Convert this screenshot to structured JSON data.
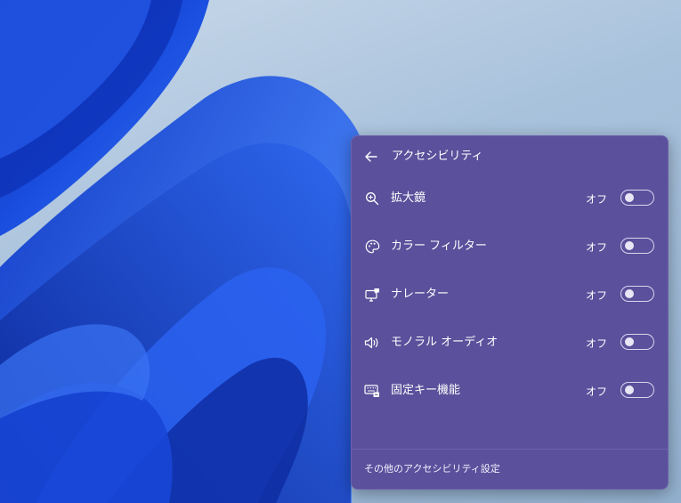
{
  "panel": {
    "title": "アクセシビリティ",
    "back_icon": "back-arrow-icon",
    "footer_link": "その他のアクセシビリティ設定"
  },
  "rows": [
    {
      "label": "拡大鏡",
      "state": "オフ",
      "icon": "magnifier-icon",
      "on": false
    },
    {
      "label": "カラー フィルター",
      "state": "オフ",
      "icon": "color-filter-icon",
      "on": false
    },
    {
      "label": "ナレーター",
      "state": "オフ",
      "icon": "narrator-icon",
      "on": false
    },
    {
      "label": "モノラル オーディオ",
      "state": "オフ",
      "icon": "mono-audio-icon",
      "on": false
    },
    {
      "label": "固定キー機能",
      "state": "オフ",
      "icon": "sticky-keys-icon",
      "on": false
    }
  ],
  "colors": {
    "panel_bg": "#5a509b",
    "text": "#ffffff",
    "wallpaper_blue": "#1f4fd8"
  }
}
